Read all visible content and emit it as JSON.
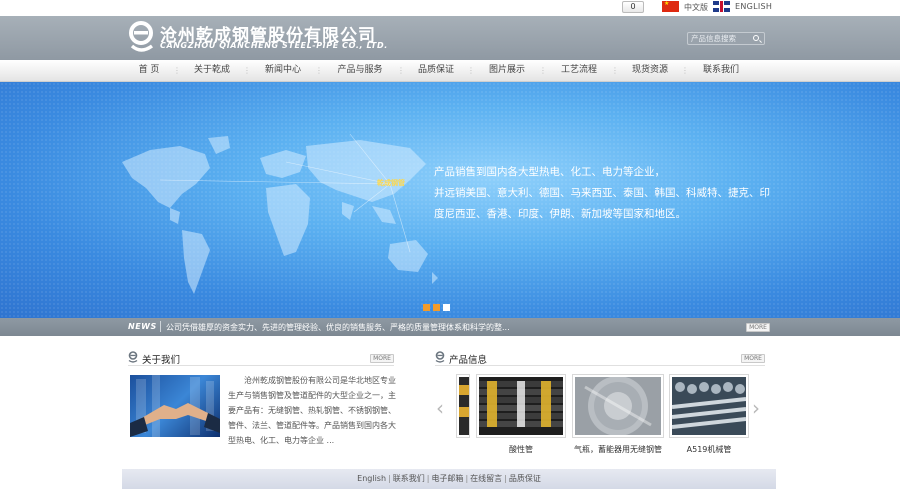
{
  "topbar": {
    "counter": "0",
    "lang_cn": "中文版",
    "lang_en": "ENGLISH"
  },
  "header": {
    "logo_cn": "沧州乾成钢管股份有限公司",
    "logo_en": "CANGZHOU QIANCHENG STEEL-PIPE CO., LTD.",
    "search_placeholder": "产品信息搜索"
  },
  "nav": {
    "items": [
      "首 页",
      "关于乾成",
      "新闻中心",
      "产品与服务",
      "品质保证",
      "图片展示",
      "工艺流程",
      "现货资源",
      "联系我们"
    ]
  },
  "banner": {
    "map_label": "乾成钢管",
    "lines": [
      "产品销售到国内各大型热电、化工、电力等企业，",
      "并远销美国、意大利、德国、马来西亚、泰国、韩国、科威特、捷克、印度尼西亚、香港、印度、伊朗、新加坡等国家和地区。"
    ]
  },
  "news": {
    "title": "NEWS",
    "text": "公司凭借雄厚的资金实力、先进的管理经验、优良的销售服务、严格的质量管理体系和科学的整...",
    "more": "MORE"
  },
  "about": {
    "title": "关于我们",
    "more": "MORE",
    "text": "沧州乾成钢管股份有限公司是华北地区专业生产与销售钢管及管道配件的大型企业之一，主要产品有：无缝钢管、热轧钢管、不锈钢钢管、管件、法兰、管道配件等。产品销售到国内各大型热电、化工、电力等企业 ..."
  },
  "products": {
    "title": "产品信息",
    "more": "MORE",
    "items": [
      {
        "caption": "酸性管"
      },
      {
        "caption": "气瓶，蓄能器用无缝钢管"
      },
      {
        "caption": "A519机械管"
      }
    ]
  },
  "footer": {
    "links": [
      "English",
      "联系我们",
      "电子邮箱",
      "在线留言",
      "品质保证"
    ]
  },
  "colors": {
    "header_bg": "#9aa3ac",
    "banner_blue": "#4a9be8",
    "dot_active": "#f39b2a"
  }
}
